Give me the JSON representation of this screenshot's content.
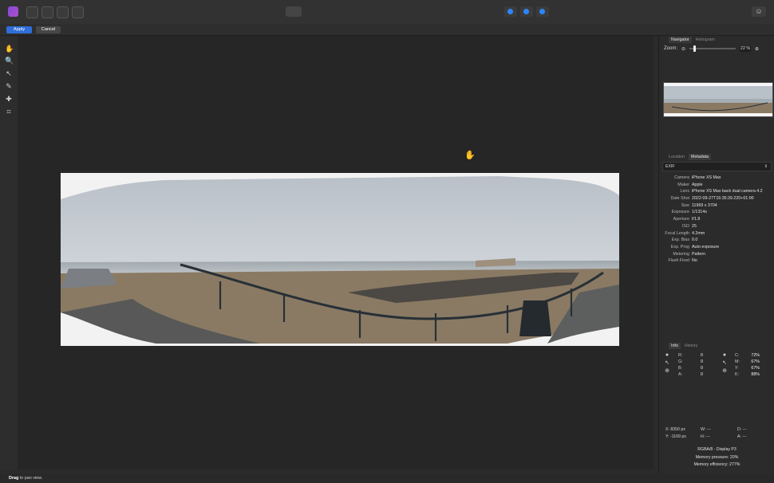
{
  "toolbar": {
    "persona_icons": [
      "photo-persona-icon",
      "liquify-persona-icon",
      "develop-persona-icon",
      "tone-mapping-persona-icon",
      "export-persona-icon"
    ],
    "center_tool_icon": "brush-tool-icon",
    "mode_icons": [
      "blue-mode-icon-1",
      "blue-mode-icon-2",
      "blue-mode-icon-3"
    ],
    "account_icon": "user-icon",
    "apply_label": "Apply",
    "cancel_label": "Cancel"
  },
  "tools": [
    "hand-tool-icon",
    "zoom-tool-icon",
    "move-tool-icon",
    "brush-tool-icon",
    "patch-tool-icon",
    "crop-tool-icon"
  ],
  "navigator": {
    "tab_navigator": "Navigator",
    "tab_histogram": "Histogram",
    "zoom_label": "Zoom:",
    "zoom_value": "22 %"
  },
  "metadata_panel": {
    "tab_location": "Location",
    "tab_metadata": "Metadata",
    "dropdown_value": "EXIF",
    "rows": [
      {
        "label": "Camera",
        "value": "iPhone XS Max"
      },
      {
        "label": "Maker",
        "value": "Apple"
      },
      {
        "label": "Lens",
        "value": "iPhone XS Max back dual camera 4.2"
      },
      {
        "label": "Date Shot",
        "value": "2022-09-27T16:35:39.220+01:00"
      },
      {
        "label": "Size",
        "value": "11969 x 3704"
      },
      {
        "label": "Exposure",
        "value": "1/1314s"
      },
      {
        "label": "Aperture",
        "value": "f/1.8"
      },
      {
        "label": "ISO",
        "value": "25"
      },
      {
        "label": "Focal Length",
        "value": "4.2mm"
      },
      {
        "label": "Exp. Bias",
        "value": "0.0"
      },
      {
        "label": "Exp. Prog",
        "value": "Auto exposure"
      },
      {
        "label": "Metering",
        "value": "Pattern"
      },
      {
        "label": "Flash Fired",
        "value": "No"
      }
    ]
  },
  "info_panel": {
    "tab_info": "Info",
    "tab_history": "History",
    "rgb": [
      {
        "label": "R:",
        "value": "0"
      },
      {
        "label": "G:",
        "value": "0"
      },
      {
        "label": "B:",
        "value": "0"
      },
      {
        "label": "A:",
        "value": "0"
      }
    ],
    "cmyk": [
      {
        "label": "C:",
        "value": "72%"
      },
      {
        "label": "M:",
        "value": "67%"
      },
      {
        "label": "Y:",
        "value": "67%"
      },
      {
        "label": "K:",
        "value": "88%"
      }
    ],
    "coords": {
      "x": "X: 8350 px",
      "y": "Y: -1169 px",
      "w": "W: ---",
      "h": "H: ---",
      "d": "D: ---",
      "a": "A: ---"
    },
    "footer": {
      "color_profile": "RGBA/8 - Display P3",
      "memory_pressure": "Memory pressure: 20%",
      "memory_efficiency": "Memory efficiency: 277%"
    }
  },
  "status": {
    "drag_word": "Drag",
    "text": "to pan view."
  },
  "colors": {
    "accent": "#2f6ed8",
    "canvas_bg": "#262626"
  }
}
